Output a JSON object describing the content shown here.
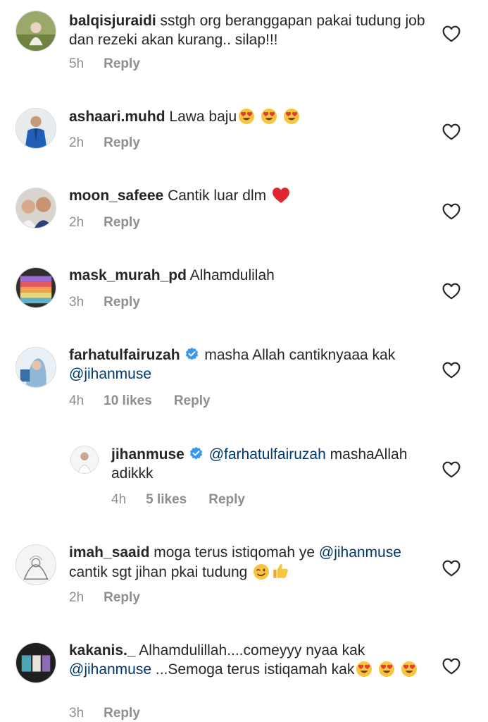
{
  "comments": [
    {
      "user": "balqisjuraidi",
      "text": "sstgh org beranggapan pakai tudung job dan rezeki akan kurang.. silap!!!",
      "time": "5h",
      "reply": "Reply"
    },
    {
      "user": "ashaari.muhd",
      "text": "Lawa baju",
      "emojis": [
        "heart-eyes",
        "heart-eyes",
        "heart-eyes"
      ],
      "time": "2h",
      "reply": "Reply"
    },
    {
      "user": "moon_safeee",
      "text": "Cantik luar dlm",
      "emojis": [
        "red-heart"
      ],
      "time": "2h",
      "reply": "Reply"
    },
    {
      "user": "mask_murah_pd",
      "text": "Alhamdulilah",
      "time": "3h",
      "reply": "Reply"
    },
    {
      "user": "farhatulfairuzah",
      "verified": true,
      "text": "masha Allah cantiknyaaa kak",
      "mention": "@jihanmuse",
      "time": "4h",
      "likes": "10 likes",
      "reply": "Reply"
    },
    {
      "user": "jihanmuse",
      "verified": true,
      "mention": "@farhatulfairuzah",
      "text": "mashaAllah adikkk",
      "time": "4h",
      "likes": "5 likes",
      "reply": "Reply"
    },
    {
      "user": "imah_saaid",
      "text": "moga terus istiqomah ye",
      "mention": "@jihanmuse",
      "text2": "cantik sgt jihan pkai tudung",
      "emojis": [
        "winking-face",
        "thumbs-up"
      ],
      "time": "2h",
      "reply": "Reply"
    },
    {
      "user": "kakanis._",
      "text": "Alhamdulillah....comeyyy nyaa kak",
      "mention": "@jihanmuse",
      "text2": "...Semoga terus istiqamah kak",
      "emojis": [
        "heart-eyes",
        "heart-eyes",
        "heart-eyes"
      ],
      "time": "3h",
      "reply": "Reply"
    }
  ],
  "colors": {
    "text": "#262626",
    "meta": "#8e8e8e",
    "mention": "#00376b",
    "verified": "#3897f0",
    "heart": "#262626"
  }
}
